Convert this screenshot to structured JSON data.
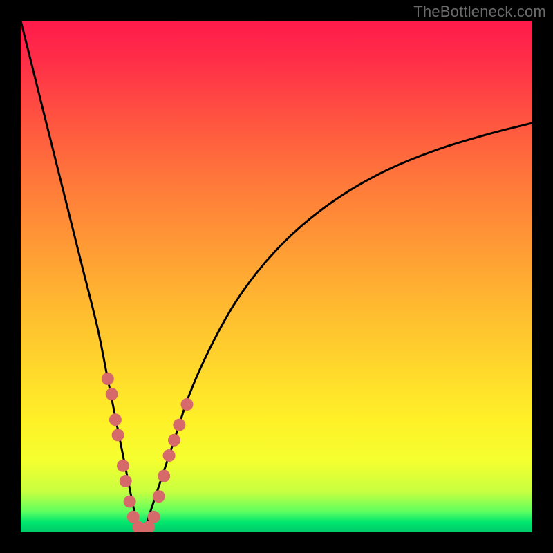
{
  "watermark": "TheBottleneck.com",
  "chart_data": {
    "type": "line",
    "title": "",
    "xlabel": "",
    "ylabel": "",
    "xlim": [
      0,
      100
    ],
    "ylim": [
      0,
      100
    ],
    "grid": false,
    "legend": false,
    "series": [
      {
        "name": "bottleneck-curve",
        "x": [
          0,
          3,
          6,
          9,
          12,
          15,
          17,
          19,
          21,
          22.5,
          24,
          25,
          27,
          30,
          33,
          37,
          42,
          48,
          55,
          63,
          72,
          82,
          92,
          100
        ],
        "values": [
          100,
          88,
          76,
          64,
          52,
          40,
          30,
          20,
          10,
          3,
          0,
          3,
          9,
          18,
          27,
          36,
          45,
          53,
          60,
          66,
          71,
          75,
          78,
          80
        ]
      }
    ],
    "markers": {
      "name": "highlighted-points",
      "color": "#d66a6a",
      "dot_radius_px": 9,
      "points": [
        {
          "x": 17.0,
          "y": 30
        },
        {
          "x": 17.8,
          "y": 27
        },
        {
          "x": 18.5,
          "y": 22
        },
        {
          "x": 19.0,
          "y": 19
        },
        {
          "x": 20.0,
          "y": 13
        },
        {
          "x": 20.5,
          "y": 10
        },
        {
          "x": 21.3,
          "y": 6
        },
        {
          "x": 22.0,
          "y": 3
        },
        {
          "x": 23.0,
          "y": 1
        },
        {
          "x": 24.0,
          "y": 0
        },
        {
          "x": 25.0,
          "y": 1
        },
        {
          "x": 26.0,
          "y": 3
        },
        {
          "x": 27.0,
          "y": 7
        },
        {
          "x": 28.0,
          "y": 11
        },
        {
          "x": 29.0,
          "y": 15
        },
        {
          "x": 30.0,
          "y": 18
        },
        {
          "x": 31.0,
          "y": 21
        },
        {
          "x": 32.5,
          "y": 25
        }
      ]
    },
    "gradient_stops": [
      {
        "pos": 0.0,
        "color": "#ff1a4b"
      },
      {
        "pos": 0.08,
        "color": "#ff2f48"
      },
      {
        "pos": 0.2,
        "color": "#ff5640"
      },
      {
        "pos": 0.32,
        "color": "#ff7a3a"
      },
      {
        "pos": 0.44,
        "color": "#ff9a35"
      },
      {
        "pos": 0.56,
        "color": "#ffba30"
      },
      {
        "pos": 0.68,
        "color": "#ffd82c"
      },
      {
        "pos": 0.78,
        "color": "#fff028"
      },
      {
        "pos": 0.86,
        "color": "#f4ff2f"
      },
      {
        "pos": 0.92,
        "color": "#c8ff40"
      },
      {
        "pos": 0.96,
        "color": "#5dff60"
      },
      {
        "pos": 0.98,
        "color": "#00e66e"
      },
      {
        "pos": 1.0,
        "color": "#00c96a"
      }
    ]
  }
}
